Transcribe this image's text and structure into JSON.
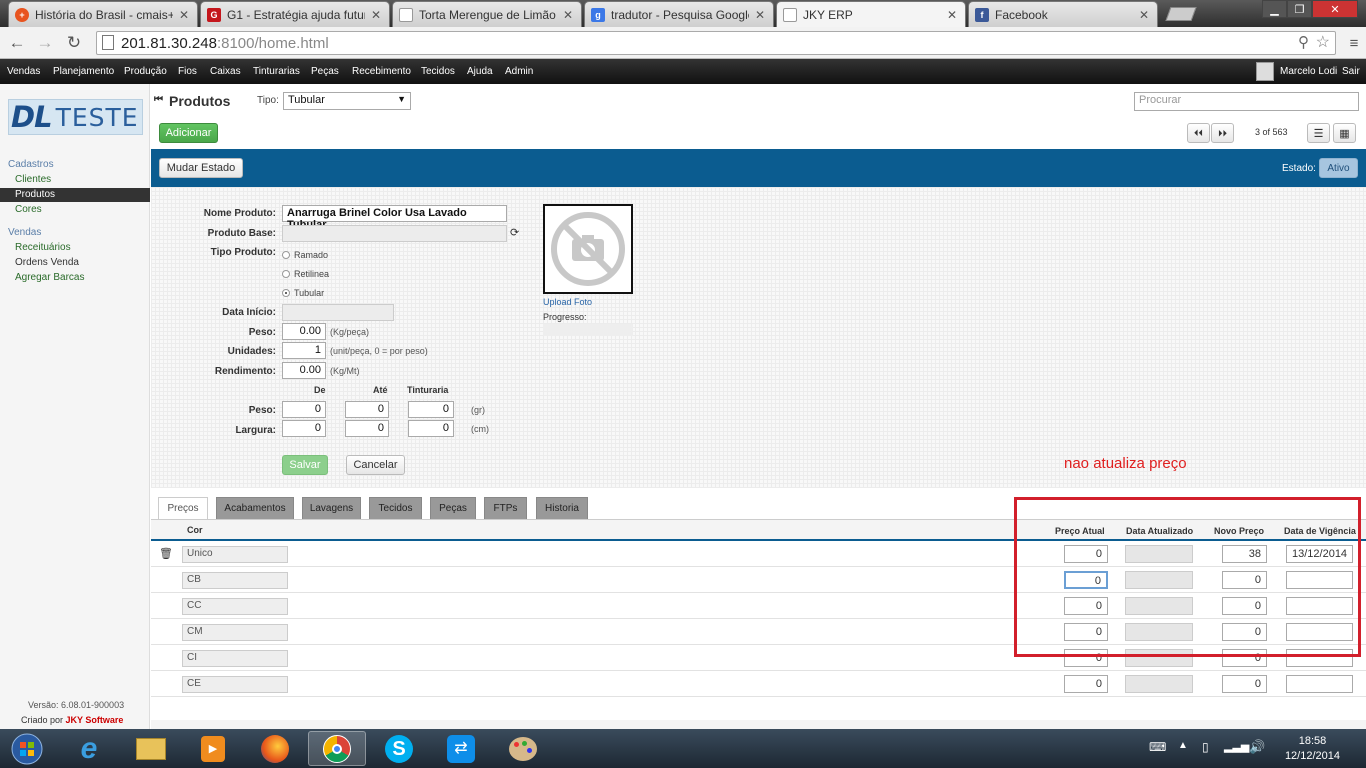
{
  "browser": {
    "tabs": [
      {
        "title": "História do Brasil - cmais+",
        "icon": "plus-favicon-icon",
        "active": false
      },
      {
        "title": "G1 - Estratégia ajuda futur",
        "icon": "g1-favicon-icon",
        "active": false
      },
      {
        "title": "Torta Merengue de Limão",
        "icon": "page-favicon-icon",
        "active": false
      },
      {
        "title": "tradutor - Pesquisa Google",
        "icon": "google-favicon-icon",
        "active": false
      },
      {
        "title": "JKY ERP",
        "icon": "page-favicon-icon",
        "active": true
      },
      {
        "title": "Facebook",
        "icon": "facebook-favicon-icon",
        "active": false
      }
    ],
    "url_host": "201.81.30.248",
    "url_rest": ":8100/home.html"
  },
  "menu": {
    "items": [
      "Vendas",
      "Planejamento",
      "Produção",
      "Fios",
      "Caixas",
      "Tinturarias",
      "Peças",
      "Recebimento",
      "Tecidos",
      "Ajuda",
      "Admin"
    ],
    "user": "Marcelo Lodi",
    "logout": "Sair"
  },
  "sidebar": {
    "logo_a": "DL",
    "logo_b": "TESTE",
    "section1": "Cadastros",
    "cadastros": [
      "Clientes",
      "Produtos",
      "Cores"
    ],
    "section2": "Vendas",
    "vendas": [
      "Receituários",
      "Ordens Venda",
      "Agregar Barcas"
    ],
    "version": "Versão: 6.08.01-900003",
    "credit_prefix": "Criado por",
    "credit_brand": "JKY Software"
  },
  "header": {
    "title": "Produtos",
    "tipo_label": "Tipo:",
    "tipo_value": "Tubular",
    "search_placeholder": "Procurar",
    "add_label": "Adicionar",
    "pager": "3 of 563"
  },
  "bluebar": {
    "state_btn": "Mudar Estado",
    "estado_label": "Estado:",
    "estado_value": "Ativo"
  },
  "form": {
    "nome_label": "Nome Produto:",
    "nome_value": "Anarruga Brinel Color Usa Lavado Tubular",
    "base_label": "Produto Base:",
    "tipo_label": "Tipo Produto:",
    "tipo_options": [
      "Ramado",
      "Retilinea",
      "Tubular"
    ],
    "tipo_selected": "Tubular",
    "data_label": "Data Início:",
    "peso_label": "Peso:",
    "peso_value": "0.00",
    "peso_hint": "(Kg/peça)",
    "unid_label": "Unidades:",
    "unid_value": "1",
    "unid_hint": "(unit/peça, 0 = por peso)",
    "rend_label": "Rendimento:",
    "rend_value": "0.00",
    "rend_hint": "(Kg/Mt)",
    "col_de": "De",
    "col_ate": "Até",
    "col_tint": "Tinturaria",
    "peso2_label": "Peso:",
    "peso2_values": [
      "0",
      "0",
      "0"
    ],
    "peso2_hint": "(gr)",
    "larg_label": "Largura:",
    "larg_values": [
      "0",
      "0",
      "0"
    ],
    "larg_hint": "(cm)",
    "upload": "Upload Foto",
    "progress": "Progresso:",
    "save": "Salvar",
    "cancel": "Cancelar"
  },
  "tabs": [
    "Preços",
    "Acabamentos",
    "Lavagens",
    "Tecidos",
    "Peças",
    "FTPs",
    "Historia"
  ],
  "table": {
    "headers": {
      "cor": "Cor",
      "preco_atual": "Preço Atual",
      "data_atualizado": "Data Atualizado",
      "novo_preco": "Novo Preço",
      "data_vigencia": "Data de Vigência"
    },
    "rows": [
      {
        "cor": "Unico",
        "preco_atual": "0",
        "data_atualizado": "",
        "novo_preco": "38",
        "data_vigencia": "13/12/2014"
      },
      {
        "cor": "CB",
        "preco_atual": "0",
        "data_atualizado": "",
        "novo_preco": "0",
        "data_vigencia": ""
      },
      {
        "cor": "CC",
        "preco_atual": "0",
        "data_atualizado": "",
        "novo_preco": "0",
        "data_vigencia": ""
      },
      {
        "cor": "CM",
        "preco_atual": "0",
        "data_atualizado": "",
        "novo_preco": "0",
        "data_vigencia": ""
      },
      {
        "cor": "CI",
        "preco_atual": "0",
        "data_atualizado": "",
        "novo_preco": "0",
        "data_vigencia": ""
      },
      {
        "cor": "CE",
        "preco_atual": "0",
        "data_atualizado": "",
        "novo_preco": "0",
        "data_vigencia": ""
      }
    ]
  },
  "annotation": "nao atualiza preço",
  "taskbar": {
    "apps": [
      "start-orb-icon",
      "internet-explorer-icon",
      "file-explorer-icon",
      "media-player-icon",
      "firefox-icon",
      "chrome-icon",
      "skype-icon",
      "teamviewer-icon",
      "paint-icon"
    ],
    "time": "18:58",
    "date": "12/12/2014"
  },
  "colors": {
    "accent_blue": "#0b5c90",
    "button_green": "#4aa74a",
    "annotation_red": "#d21f2b"
  }
}
